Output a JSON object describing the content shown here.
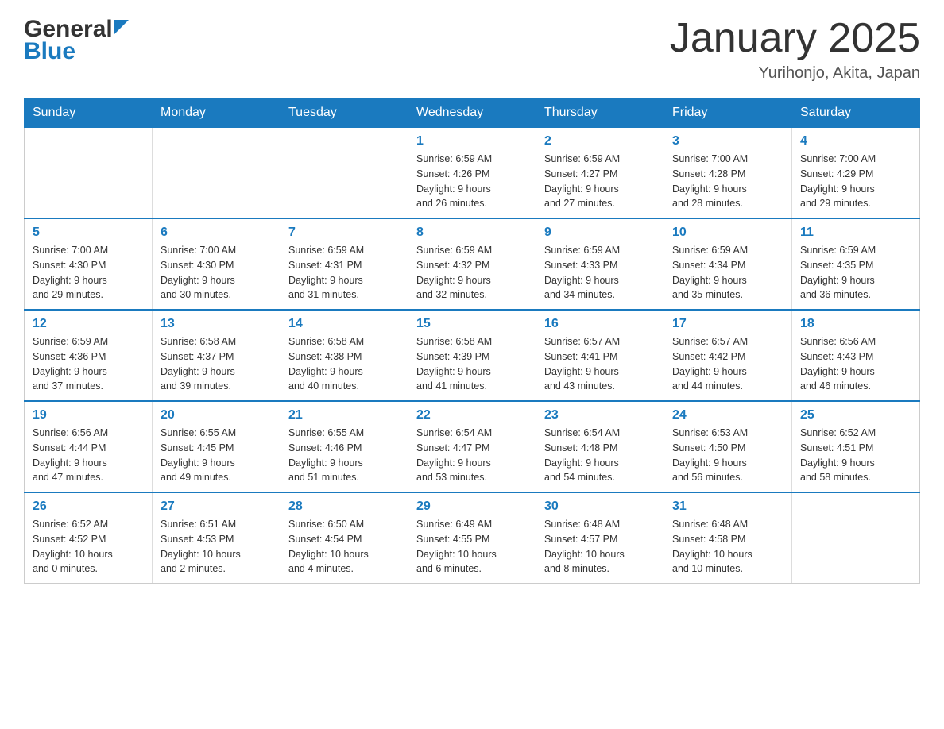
{
  "header": {
    "logo_general": "General",
    "logo_blue": "Blue",
    "month_title": "January 2025",
    "location": "Yurihonjo, Akita, Japan"
  },
  "days_of_week": [
    "Sunday",
    "Monday",
    "Tuesday",
    "Wednesday",
    "Thursday",
    "Friday",
    "Saturday"
  ],
  "weeks": [
    [
      {
        "day": "",
        "info": ""
      },
      {
        "day": "",
        "info": ""
      },
      {
        "day": "",
        "info": ""
      },
      {
        "day": "1",
        "info": "Sunrise: 6:59 AM\nSunset: 4:26 PM\nDaylight: 9 hours\nand 26 minutes."
      },
      {
        "day": "2",
        "info": "Sunrise: 6:59 AM\nSunset: 4:27 PM\nDaylight: 9 hours\nand 27 minutes."
      },
      {
        "day": "3",
        "info": "Sunrise: 7:00 AM\nSunset: 4:28 PM\nDaylight: 9 hours\nand 28 minutes."
      },
      {
        "day": "4",
        "info": "Sunrise: 7:00 AM\nSunset: 4:29 PM\nDaylight: 9 hours\nand 29 minutes."
      }
    ],
    [
      {
        "day": "5",
        "info": "Sunrise: 7:00 AM\nSunset: 4:30 PM\nDaylight: 9 hours\nand 29 minutes."
      },
      {
        "day": "6",
        "info": "Sunrise: 7:00 AM\nSunset: 4:30 PM\nDaylight: 9 hours\nand 30 minutes."
      },
      {
        "day": "7",
        "info": "Sunrise: 6:59 AM\nSunset: 4:31 PM\nDaylight: 9 hours\nand 31 minutes."
      },
      {
        "day": "8",
        "info": "Sunrise: 6:59 AM\nSunset: 4:32 PM\nDaylight: 9 hours\nand 32 minutes."
      },
      {
        "day": "9",
        "info": "Sunrise: 6:59 AM\nSunset: 4:33 PM\nDaylight: 9 hours\nand 34 minutes."
      },
      {
        "day": "10",
        "info": "Sunrise: 6:59 AM\nSunset: 4:34 PM\nDaylight: 9 hours\nand 35 minutes."
      },
      {
        "day": "11",
        "info": "Sunrise: 6:59 AM\nSunset: 4:35 PM\nDaylight: 9 hours\nand 36 minutes."
      }
    ],
    [
      {
        "day": "12",
        "info": "Sunrise: 6:59 AM\nSunset: 4:36 PM\nDaylight: 9 hours\nand 37 minutes."
      },
      {
        "day": "13",
        "info": "Sunrise: 6:58 AM\nSunset: 4:37 PM\nDaylight: 9 hours\nand 39 minutes."
      },
      {
        "day": "14",
        "info": "Sunrise: 6:58 AM\nSunset: 4:38 PM\nDaylight: 9 hours\nand 40 minutes."
      },
      {
        "day": "15",
        "info": "Sunrise: 6:58 AM\nSunset: 4:39 PM\nDaylight: 9 hours\nand 41 minutes."
      },
      {
        "day": "16",
        "info": "Sunrise: 6:57 AM\nSunset: 4:41 PM\nDaylight: 9 hours\nand 43 minutes."
      },
      {
        "day": "17",
        "info": "Sunrise: 6:57 AM\nSunset: 4:42 PM\nDaylight: 9 hours\nand 44 minutes."
      },
      {
        "day": "18",
        "info": "Sunrise: 6:56 AM\nSunset: 4:43 PM\nDaylight: 9 hours\nand 46 minutes."
      }
    ],
    [
      {
        "day": "19",
        "info": "Sunrise: 6:56 AM\nSunset: 4:44 PM\nDaylight: 9 hours\nand 47 minutes."
      },
      {
        "day": "20",
        "info": "Sunrise: 6:55 AM\nSunset: 4:45 PM\nDaylight: 9 hours\nand 49 minutes."
      },
      {
        "day": "21",
        "info": "Sunrise: 6:55 AM\nSunset: 4:46 PM\nDaylight: 9 hours\nand 51 minutes."
      },
      {
        "day": "22",
        "info": "Sunrise: 6:54 AM\nSunset: 4:47 PM\nDaylight: 9 hours\nand 53 minutes."
      },
      {
        "day": "23",
        "info": "Sunrise: 6:54 AM\nSunset: 4:48 PM\nDaylight: 9 hours\nand 54 minutes."
      },
      {
        "day": "24",
        "info": "Sunrise: 6:53 AM\nSunset: 4:50 PM\nDaylight: 9 hours\nand 56 minutes."
      },
      {
        "day": "25",
        "info": "Sunrise: 6:52 AM\nSunset: 4:51 PM\nDaylight: 9 hours\nand 58 minutes."
      }
    ],
    [
      {
        "day": "26",
        "info": "Sunrise: 6:52 AM\nSunset: 4:52 PM\nDaylight: 10 hours\nand 0 minutes."
      },
      {
        "day": "27",
        "info": "Sunrise: 6:51 AM\nSunset: 4:53 PM\nDaylight: 10 hours\nand 2 minutes."
      },
      {
        "day": "28",
        "info": "Sunrise: 6:50 AM\nSunset: 4:54 PM\nDaylight: 10 hours\nand 4 minutes."
      },
      {
        "day": "29",
        "info": "Sunrise: 6:49 AM\nSunset: 4:55 PM\nDaylight: 10 hours\nand 6 minutes."
      },
      {
        "day": "30",
        "info": "Sunrise: 6:48 AM\nSunset: 4:57 PM\nDaylight: 10 hours\nand 8 minutes."
      },
      {
        "day": "31",
        "info": "Sunrise: 6:48 AM\nSunset: 4:58 PM\nDaylight: 10 hours\nand 10 minutes."
      },
      {
        "day": "",
        "info": ""
      }
    ]
  ]
}
